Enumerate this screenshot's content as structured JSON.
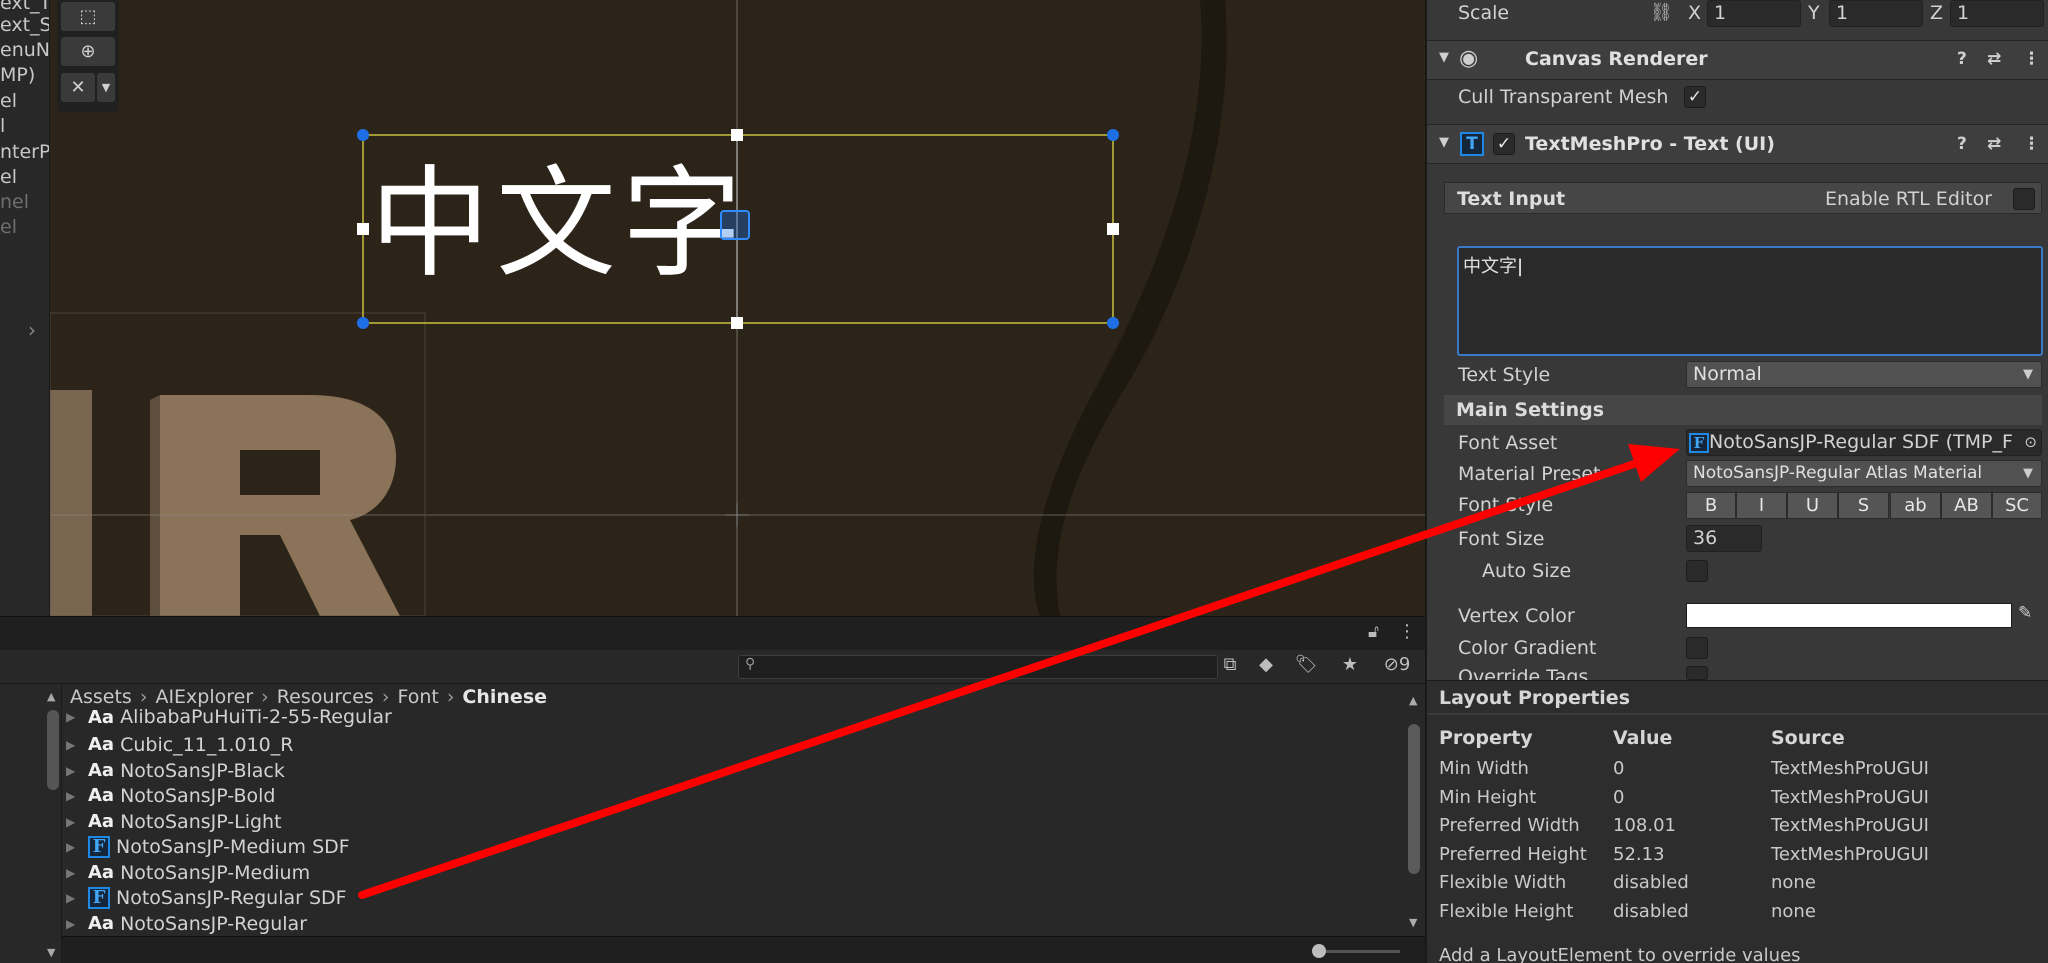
{
  "hierarchy": {
    "items": [
      {
        "label": "ext_Ti",
        "dim": false
      },
      {
        "label": "ext_Su",
        "dim": false
      },
      {
        "label": "enuNa",
        "dim": false
      },
      {
        "label": "MP)",
        "dim": false
      },
      {
        "label": "el",
        "dim": false
      },
      {
        "label": "l",
        "dim": false
      },
      {
        "label": "nterPr",
        "dim": false
      },
      {
        "label": "el",
        "dim": false
      },
      {
        "label": "nel",
        "dim": true
      },
      {
        "label": "el",
        "dim": true
      }
    ]
  },
  "scene": {
    "sample_text": "中文字",
    "tools": [
      "rect-tool-icon",
      "transform-tool-icon",
      "custom-tools-icon"
    ]
  },
  "project": {
    "breadcrumb": [
      "Assets",
      "AIExplorer",
      "Resources",
      "Font",
      "Chinese"
    ],
    "hidden_count": "9",
    "assets": [
      {
        "icon": "Aa",
        "name": "AlibabaPuHuiTi-2-55-Regular",
        "type": "font"
      },
      {
        "icon": "Aa",
        "name": "Cubic_11_1.010_R",
        "type": "font"
      },
      {
        "icon": "Aa",
        "name": "NotoSansJP-Black",
        "type": "font"
      },
      {
        "icon": "Aa",
        "name": "NotoSansJP-Bold",
        "type": "font"
      },
      {
        "icon": "Aa",
        "name": "NotoSansJP-Light",
        "type": "font"
      },
      {
        "icon": "F",
        "name": "NotoSansJP-Medium SDF",
        "type": "sdf"
      },
      {
        "icon": "Aa",
        "name": "NotoSansJP-Medium",
        "type": "font"
      },
      {
        "icon": "F",
        "name": "NotoSansJP-Regular SDF",
        "type": "sdf"
      },
      {
        "icon": "Aa",
        "name": "NotoSansJP-Regular",
        "type": "font"
      }
    ]
  },
  "inspector": {
    "transform": {
      "scale_label": "Scale",
      "x_label": "X",
      "x_value": "1",
      "y_label": "Y",
      "y_value": "1",
      "z_label": "Z",
      "z_value": "1"
    },
    "canvas_renderer": {
      "title": "Canvas Renderer",
      "cull_label": "Cull Transparent Mesh",
      "cull_checked": "✓"
    },
    "tmp": {
      "title": "TextMeshPro - Text (UI)",
      "enabled_check": "✓",
      "text_input_label": "Text Input",
      "rtl_label": "Enable RTL Editor",
      "text_value": "中文字",
      "text_style_label": "Text Style",
      "text_style_value": "Normal",
      "main_settings_label": "Main Settings",
      "font_asset_label": "Font Asset",
      "font_asset_value": "NotoSansJP-Regular SDF (TMP_F",
      "material_preset_label": "Material Preset",
      "material_preset_value": "NotoSansJP-Regular Atlas Material",
      "font_style_label": "Font Style",
      "font_style_buttons": [
        "B",
        "I",
        "U",
        "S",
        "ab",
        "AB",
        "SC"
      ],
      "font_size_label": "Font Size",
      "font_size_value": "36",
      "auto_size_label": "Auto Size",
      "vertex_color_label": "Vertex Color",
      "vertex_color": "#ffffff",
      "color_gradient_label": "Color Gradient",
      "override_tags_label": "Override Tags"
    },
    "layout_properties": {
      "title": "Layout Properties",
      "headers": [
        "Property",
        "Value",
        "Source"
      ],
      "rows": [
        [
          "Min Width",
          "0",
          "TextMeshProUGUI"
        ],
        [
          "Min Height",
          "0",
          "TextMeshProUGUI"
        ],
        [
          "Preferred Width",
          "108.01",
          "TextMeshProUGUI"
        ],
        [
          "Preferred Height",
          "52.13",
          "TextMeshProUGUI"
        ],
        [
          "Flexible Width",
          "disabled",
          "none"
        ],
        [
          "Flexible Height",
          "disabled",
          "none"
        ]
      ],
      "footer": "Add a LayoutElement to override values"
    }
  },
  "colors": {
    "annotation_arrow": "#ff0000",
    "selection_rect": "#c8c23a",
    "handle_blue": "#1e6fe6",
    "accent_blue": "#1e88e5"
  }
}
